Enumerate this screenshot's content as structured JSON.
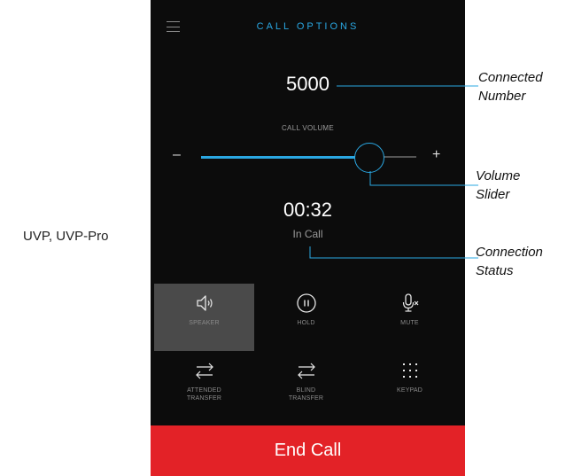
{
  "side_label": "UVP, UVP-Pro",
  "header": {
    "title": "CALL OPTIONS",
    "menu_icon": "hamburger-menu-icon"
  },
  "call": {
    "number": "5000",
    "volume_label": "CALL VOLUME",
    "volume_minus": "–",
    "volume_plus": "+",
    "volume_level": 0.72,
    "timer": "00:32",
    "status": "In Call"
  },
  "controls": [
    {
      "label": "SPEAKER",
      "icon": "speaker-icon",
      "active": true
    },
    {
      "label": "HOLD",
      "icon": "hold-icon",
      "active": false
    },
    {
      "label": "MUTE",
      "icon": "mute-icon",
      "active": false
    },
    {
      "label": "ATTENDED\nTRANSFER",
      "icon": "attended-transfer-icon",
      "active": false
    },
    {
      "label": "BLIND\nTRANSFER",
      "icon": "blind-transfer-icon",
      "active": false
    },
    {
      "label": "KEYPAD",
      "icon": "keypad-icon",
      "active": false
    }
  ],
  "end_call": "End Call",
  "annotations": {
    "connected_number": [
      "Connected",
      "Number"
    ],
    "volume_slider": [
      "Volume",
      "Slider"
    ],
    "connection_status": [
      "Connection",
      "Status"
    ]
  },
  "colors": {
    "accent": "#2aa7e2",
    "end_call": "#e32227",
    "background": "#0c0c0c"
  }
}
